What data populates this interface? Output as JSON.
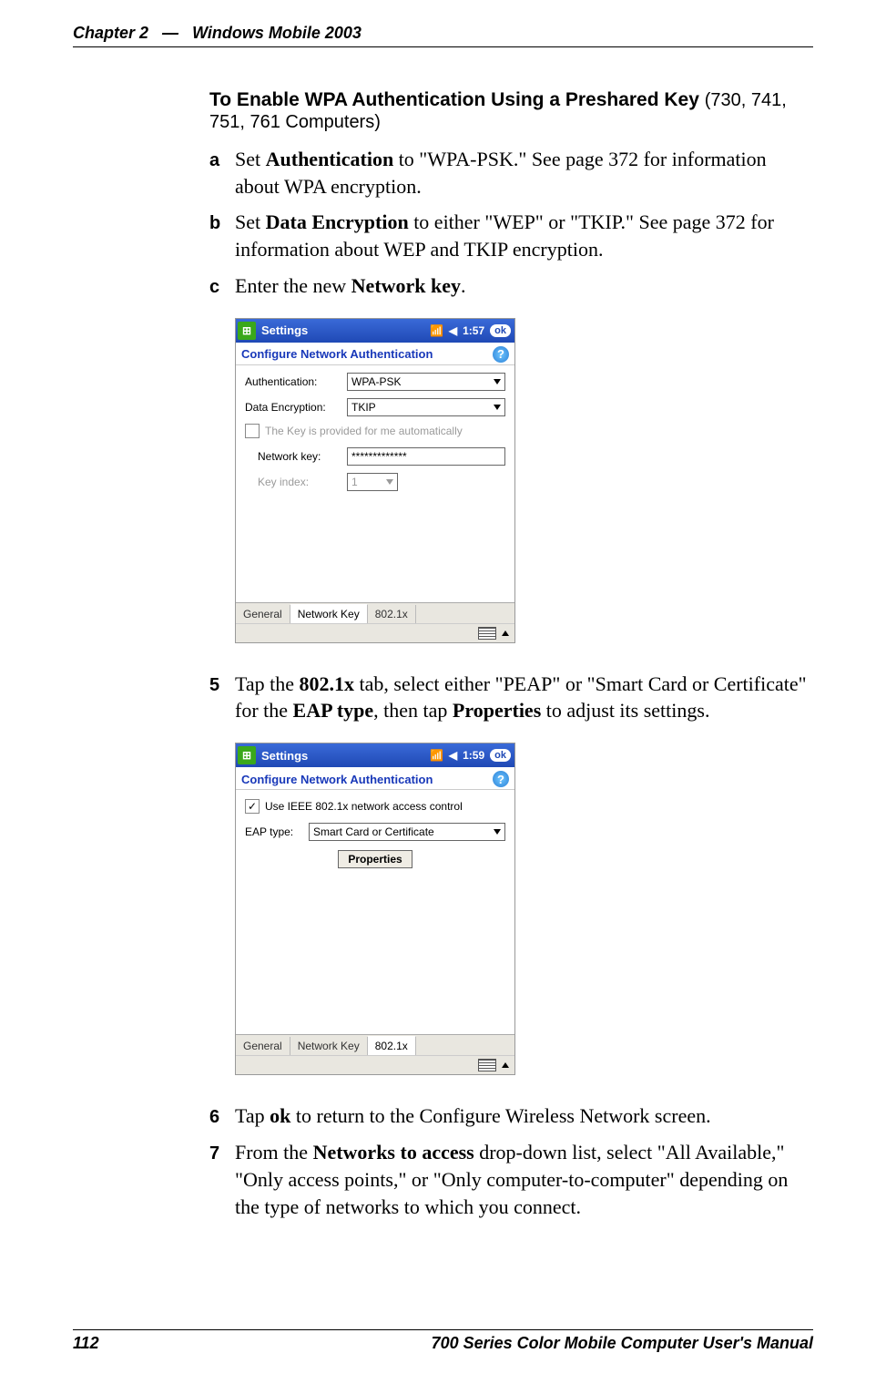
{
  "header": {
    "chapter": "Chapter 2",
    "dash": "—",
    "title": "Windows Mobile 2003"
  },
  "section": {
    "title_bold": "To Enable WPA Authentication Using a Preshared Key",
    "title_light": "(730, 741, 751, 761 Computers)"
  },
  "steps_a": {
    "marker": "a",
    "pre": "Set ",
    "bold": "Authentication",
    "post": " to \"WPA-PSK.\" See page 372 for information about WPA encryption."
  },
  "steps_b": {
    "marker": "b",
    "pre": "Set ",
    "bold": "Data Encryption",
    "post": " to either \"WEP\" or \"TKIP.\" See page 372 for information about WEP and TKIP encryption."
  },
  "steps_c": {
    "marker": "c",
    "pre": "Enter the new ",
    "bold": "Network key",
    "post": "."
  },
  "screenshot1": {
    "titlebar": "Settings",
    "time": "1:57",
    "ok": "ok",
    "subtitle": "Configure Network Authentication",
    "help": "?",
    "auth_label": "Authentication:",
    "auth_value": "WPA-PSK",
    "enc_label": "Data Encryption:",
    "enc_value": "TKIP",
    "autokey": "The Key is provided for me automatically",
    "netkey_label": "Network key:",
    "netkey_value": "*************",
    "keyidx_label": "Key index:",
    "keyidx_value": "1",
    "tabs": {
      "general": "General",
      "netkey": "Network Key",
      "dot1x": "802.1x"
    }
  },
  "step5": {
    "marker": "5",
    "t1": "Tap the ",
    "b1": "802.1x",
    "t2": " tab, select either \"PEAP\" or \"Smart Card or Certificate\" for the ",
    "b2": "EAP type",
    "t3": ", then tap ",
    "b3": "Properties",
    "t4": " to adjust its settings."
  },
  "screenshot2": {
    "titlebar": "Settings",
    "time": "1:59",
    "ok": "ok",
    "subtitle": "Configure Network Authentication",
    "help": "?",
    "use1x": "Use IEEE 802.1x network access control",
    "eap_label": "EAP type:",
    "eap_value": "Smart Card or Certificate",
    "props_btn": "Properties",
    "tabs": {
      "general": "General",
      "netkey": "Network Key",
      "dot1x": "802.1x"
    }
  },
  "step6": {
    "marker": "6",
    "t1": "Tap ",
    "b1": "ok",
    "t2": " to return to the Configure Wireless Network screen."
  },
  "step7": {
    "marker": "7",
    "t1": "From the ",
    "b1": "Networks to access",
    "t2": " drop-down list, select \"All Available,\" \"Only access points,\" or \"Only computer-to-computer\" depending on the type of networks to which you connect."
  },
  "footer": {
    "page": "112",
    "manual": "700 Series Color Mobile Computer User's Manual"
  }
}
